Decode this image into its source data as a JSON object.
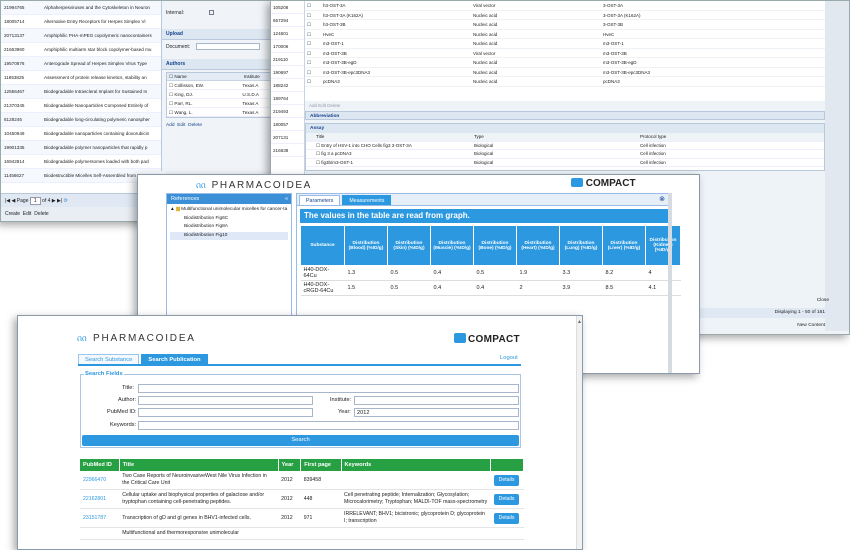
{
  "w1": {
    "ids": [
      "21994765",
      "18005714",
      "20713137",
      "21663960",
      "19570876",
      "11853825",
      "12556467",
      "21370345",
      "6128245",
      "10450949",
      "19901335",
      "16942814",
      "11456627"
    ],
    "titles": [
      "Alphaherpesviruses and the Cytoskeleton in Neuron",
      "Alternative Entry Receptors for Herpes Simplex Vi",
      "Amphiphilic PHA-mPEG copolymeric nanocontainers",
      "Amphiphilic multiarm star block copolymer-based mu",
      "Anterograde Spread of Herpes Simplex Virus Type",
      "Assessment of protein release kinetics, stability an",
      "Biodegradable Intrascleral Implant for Sustained In",
      "Biodegradable Nanoparticles Composed Entirely of",
      "Biodegradable long-circulating polymeric nanospher",
      "Biodegradable nanoparticles containing doxorubicin",
      "Biodegradable polymer nanoparticles that rapidly p",
      "Biodegradable polymersomes loaded with both pacl",
      "Biodestructible Micelles Self-Assembled from Ar"
    ],
    "pager": {
      "page_label": "Page",
      "page": "1",
      "of": "of 4"
    },
    "actions": [
      "Create",
      "Edit",
      "Delete"
    ],
    "form": {
      "internal_label": "Internal:",
      "upload_section": "Upload",
      "document_label": "Document:",
      "authors_section": "Authors",
      "author_cols": [
        "Name",
        "Institute"
      ],
      "authors": [
        {
          "name": "Collisson, EW.",
          "inst": "Texas A"
        },
        {
          "name": "King, DJ.",
          "inst": "U.S.D.A"
        },
        {
          "name": "Parr, RL.",
          "inst": "Texas A"
        },
        {
          "name": "Wang, L.",
          "inst": "Texas A"
        }
      ],
      "author_actions": [
        "Add",
        "Edit",
        "Delete"
      ]
    }
  },
  "w2": {
    "left_ids": [
      "105208",
      "657294",
      "124601",
      "170006",
      "219110",
      "190697",
      "188242",
      "189764",
      "219493",
      "180057",
      "207131",
      "216638"
    ],
    "rows": [
      {
        "a": "h3-OST-3A",
        "b": "Viral vector",
        "c": "3-OST-3A"
      },
      {
        "a": "h3-OST-3A (K162A)",
        "b": "Nucleic acid",
        "c": "3-OST-3A (K162A)"
      },
      {
        "a": "h3-OST-3B",
        "b": "Nucleic acid",
        "c": "3-OST-3B"
      },
      {
        "a": "HveC",
        "b": "Nucleic acid",
        "c": "HveC"
      },
      {
        "a": "m3-OST-1",
        "b": "Nucleic acid",
        "c": "m3-OST-1"
      },
      {
        "a": "m3-OST-3B",
        "b": "Viral vector",
        "c": "m3-OST-3B"
      },
      {
        "a": "m3-OST-3B-egD",
        "b": "Nucleic acid",
        "c": "m3-OST-3B-egD"
      },
      {
        "a": "m3-OST-3B-epc3DNA3",
        "b": "Nucleic acid",
        "c": "m3-OST-3B-epc3DNA3"
      },
      {
        "a": "pcDNA3",
        "b": "Nucleic acid",
        "c": "pcDNA3"
      }
    ],
    "grid_actions": "Add   Edit   Delete",
    "abbr_label": "Abbreviation",
    "assay_label": "Assay",
    "assay_cols": [
      "Title",
      "Type",
      "Protocol type"
    ],
    "assay_rows": [
      {
        "a": "Entry of HSV-1 into CHO Cells fig3 3-OST-3A",
        "b": "Biological",
        "c": "Cell infection"
      },
      {
        "a": "fig 3 a pcDNA3",
        "b": "Biological",
        "c": "Cell infection"
      },
      {
        "a": "fig3b/m3-OST-1",
        "b": "Biological",
        "c": "Cell infection"
      }
    ],
    "close_label": "Close",
    "displaying": "Displaying 1 - 50 of 161",
    "new_content": "New Content"
  },
  "w3": {
    "logo": "PHARMACOIDEA",
    "compact": "COMPACT",
    "ref_header": "References",
    "tree_root": "Multifunctional unimolecular micelles for cancer-ta",
    "tree_items": [
      "Biodistribution Fig6C",
      "Biodistribution Fig8A",
      "Biodistribution Fig10"
    ],
    "tabs": [
      "Parameters",
      "Measurements"
    ],
    "banner": "The values in the table are read from graph.",
    "headers": [
      "Substance",
      "Distribution (Blood) (%ID/g)",
      "Distribution (Skin) (%ID/g)",
      "Distribution (Muscle) (%ID/g)",
      "Distribution (Bone) (%ID/g)",
      "Distribution (Heart) (%ID/g)",
      "Distribution (Lung) (%ID/g)",
      "Distribution (Liver) (%ID/g)",
      "Distribution (Kidney) (%ID/g)"
    ],
    "rows": [
      [
        "H40-DOX-64Cu",
        "1.3",
        "0.5",
        "0.4",
        "0.5",
        "1.9",
        "3.3",
        "8.2",
        "4"
      ],
      [
        "H40-DOX-cRGD-64Cu",
        "1.5",
        "0.5",
        "0.4",
        "0.4",
        "2",
        "3.9",
        "8.5",
        "4.1"
      ]
    ]
  },
  "w4": {
    "logo": "PHARMACOIDEA",
    "compact": "COMPACT",
    "tabs": [
      "Search Substance",
      "Search Publication"
    ],
    "logout": "Logout",
    "fieldset_legend": "Search Fields",
    "labels": {
      "title": "Title:",
      "author": "Author:",
      "institute": "Institute:",
      "pubmed": "PubMed ID:",
      "year": "Year:",
      "keywords": "Keywords:"
    },
    "year_value": "2012",
    "search_label": "Search",
    "cols": [
      "PubMed ID",
      "Title",
      "Year",
      "First page",
      "Keywords",
      ""
    ],
    "details_label": "Details",
    "results": [
      {
        "id": "22966470",
        "title": "Two Case Reports of NeuroinvasiveWest Nile Virus Infection in the Critical Care Unit",
        "year": "2012",
        "page": "839458",
        "kw": ""
      },
      {
        "id": "22162801",
        "title": "Cellular uptake and biophysical properties of galactose and/or tryptophan containing cell-penetrating peptides.",
        "year": "2012",
        "page": "448",
        "kw": "Cell penetrating peptide; Internalization; Glycosylation; Microcalorimetry; Tryptophan; MALDI-TOF mass-spectrometry"
      },
      {
        "id": "23151787",
        "title": "Transcription of gD and gI genes in BHV1-infected cells.",
        "year": "2012",
        "page": "971",
        "kw": "IRRELEVANT; BHV1; bicistronic; glycoprotein D; glycoprotein I; transcription"
      },
      {
        "id": "",
        "title": "Multifunctional and thermoresponsive unimolecular",
        "year": "",
        "page": "",
        "kw": ""
      }
    ]
  }
}
